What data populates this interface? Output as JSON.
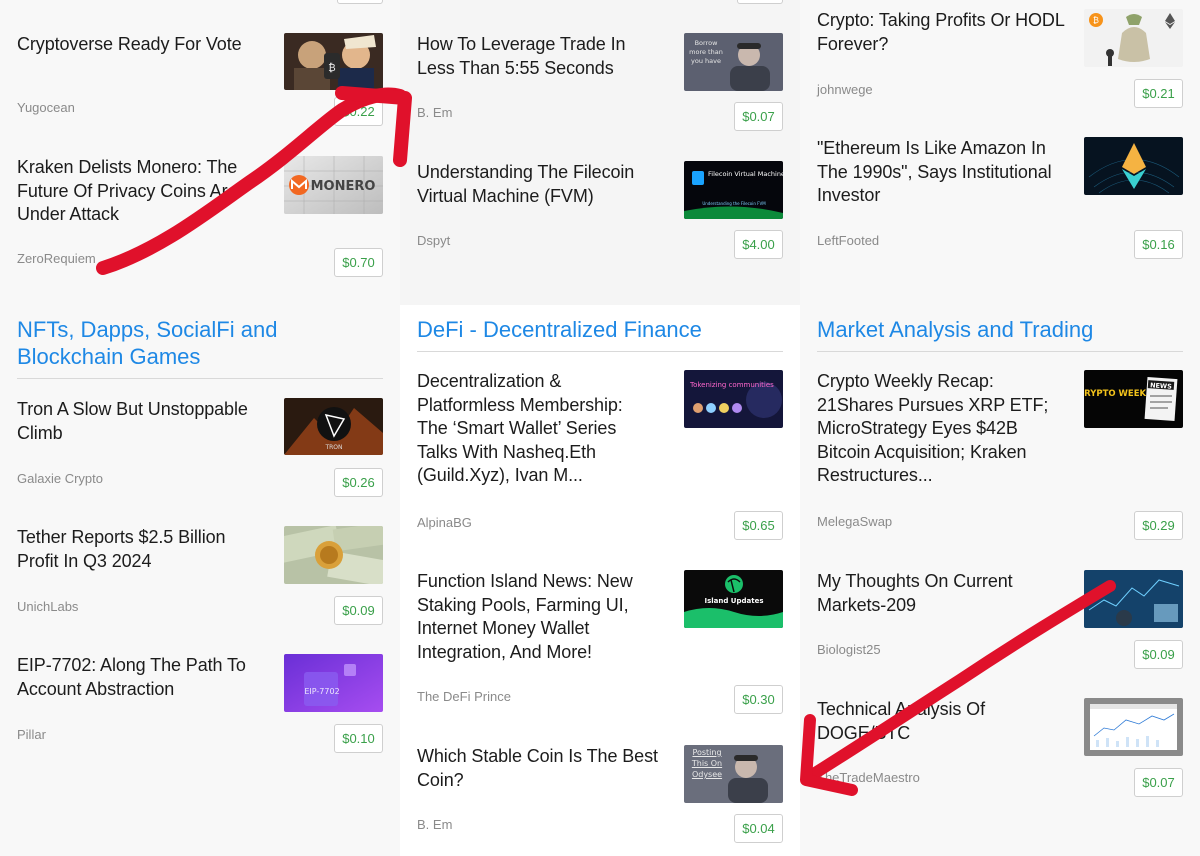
{
  "columns": [
    {
      "top_articles": [
        {
          "title": "Cryptoverse Ready For Vote",
          "author": "Yugocean",
          "price": "$0.22",
          "thumb_icon": "election-portraits-thumbnail"
        },
        {
          "title": "Kraken Delists Monero: The Future Of Privacy Coins Are Under Attack",
          "author": "ZeroRequiem",
          "price": "$0.70",
          "thumb_icon": "monero-logo-thumbnail",
          "thumb_text": "MONERO"
        }
      ],
      "section": {
        "title": "NFTs, Dapps, SocialFi and Blockchain Games",
        "articles": [
          {
            "title": "Tron A Slow But Unstoppable Climb",
            "author": "Galaxie Crypto",
            "price": "$0.26",
            "thumb_icon": "tron-logo-thumbnail",
            "thumb_text": "TRON"
          },
          {
            "title": "Tether Reports $2.5 Billion Profit In Q3 2024",
            "author": "UnichLabs",
            "price": "$0.09",
            "thumb_icon": "dollar-bills-thumbnail"
          },
          {
            "title": "EIP-7702: Along The Path To Account Abstraction",
            "author": "Pillar",
            "price": "$0.10",
            "thumb_icon": "eip-7702-purple-thumbnail",
            "thumb_text": "EIP-7702"
          }
        ]
      }
    },
    {
      "top_articles": [
        {
          "title": "How To Leverage Trade In Less Than 5:55 Seconds",
          "author": "B. Em",
          "price": "$0.07",
          "thumb_icon": "video-portrait-thumbnail",
          "thumb_text": "Borrow more than you have"
        },
        {
          "title": "Understanding The Filecoin Virtual Machine (FVM)",
          "author": "Dspyt",
          "price": "$4.00",
          "thumb_icon": "filecoin-fvm-thumbnail",
          "thumb_text": "Filecoin Virtual Machine",
          "thumb_sub": "Understanding the Filecoin FVM"
        }
      ],
      "section": {
        "title": "DeFi - Decentralized Finance",
        "articles": [
          {
            "title": "Decentralization & Platformless Membership: The ‘Smart Wallet’ Series Talks With Nasheq.Eth (Guild.Xyz), Ivan M...",
            "author": "AlpinaBG",
            "price": "$0.65",
            "thumb_icon": "tokenizing-communities-thumbnail",
            "thumb_text": "Tokenizing communities"
          },
          {
            "title": "Function Island News: New Staking Pools, Farming UI, Internet Money Wallet Integration, And More!",
            "author": "The DeFi Prince",
            "price": "$0.30",
            "thumb_icon": "island-updates-thumbnail",
            "thumb_text": "Island Updates"
          },
          {
            "title": "Which Stable Coin Is The Best Coin?",
            "author": "B. Em",
            "price": "$0.04",
            "thumb_icon": "video-portrait-thumbnail",
            "thumb_text": "Posting This On Odysee"
          }
        ]
      }
    },
    {
      "top_articles": [
        {
          "title": "Crypto: Taking Profits Or HODL Forever?",
          "author": "johnwege",
          "price": "$0.21",
          "thumb_icon": "crypto-coins-money-bag-thumbnail"
        },
        {
          "title": "\"Ethereum Is Like Amazon In The 1990s\", Says Institutional Investor",
          "author": "LeftFooted",
          "price": "$0.16",
          "thumb_icon": "ethereum-logo-thumbnail"
        }
      ],
      "section": {
        "title": "Market Analysis and Trading",
        "articles": [
          {
            "title": "Crypto Weekly Recap: 21Shares Pursues XRP ETF; MicroStrategy Eyes $42B Bitcoin Acquisition; Kraken Restructures...",
            "author": "MelegaSwap",
            "price": "$0.29",
            "thumb_icon": "crypto-week-news-thumbnail",
            "thumb_text": "CRYPTO WEEK",
            "thumb_sub": "NEWS"
          },
          {
            "title": "My Thoughts On Current Markets-209",
            "author": "Biologist25",
            "price": "$0.09",
            "thumb_icon": "trading-screens-thumbnail"
          },
          {
            "title": "Technical Analysis Of DOGE/BTC",
            "author": "TheTradeMaestro",
            "price": "$0.07",
            "thumb_icon": "chart-screenshot-thumbnail"
          }
        ]
      }
    }
  ],
  "annotations": {
    "arrow_color": "#e0112b"
  }
}
